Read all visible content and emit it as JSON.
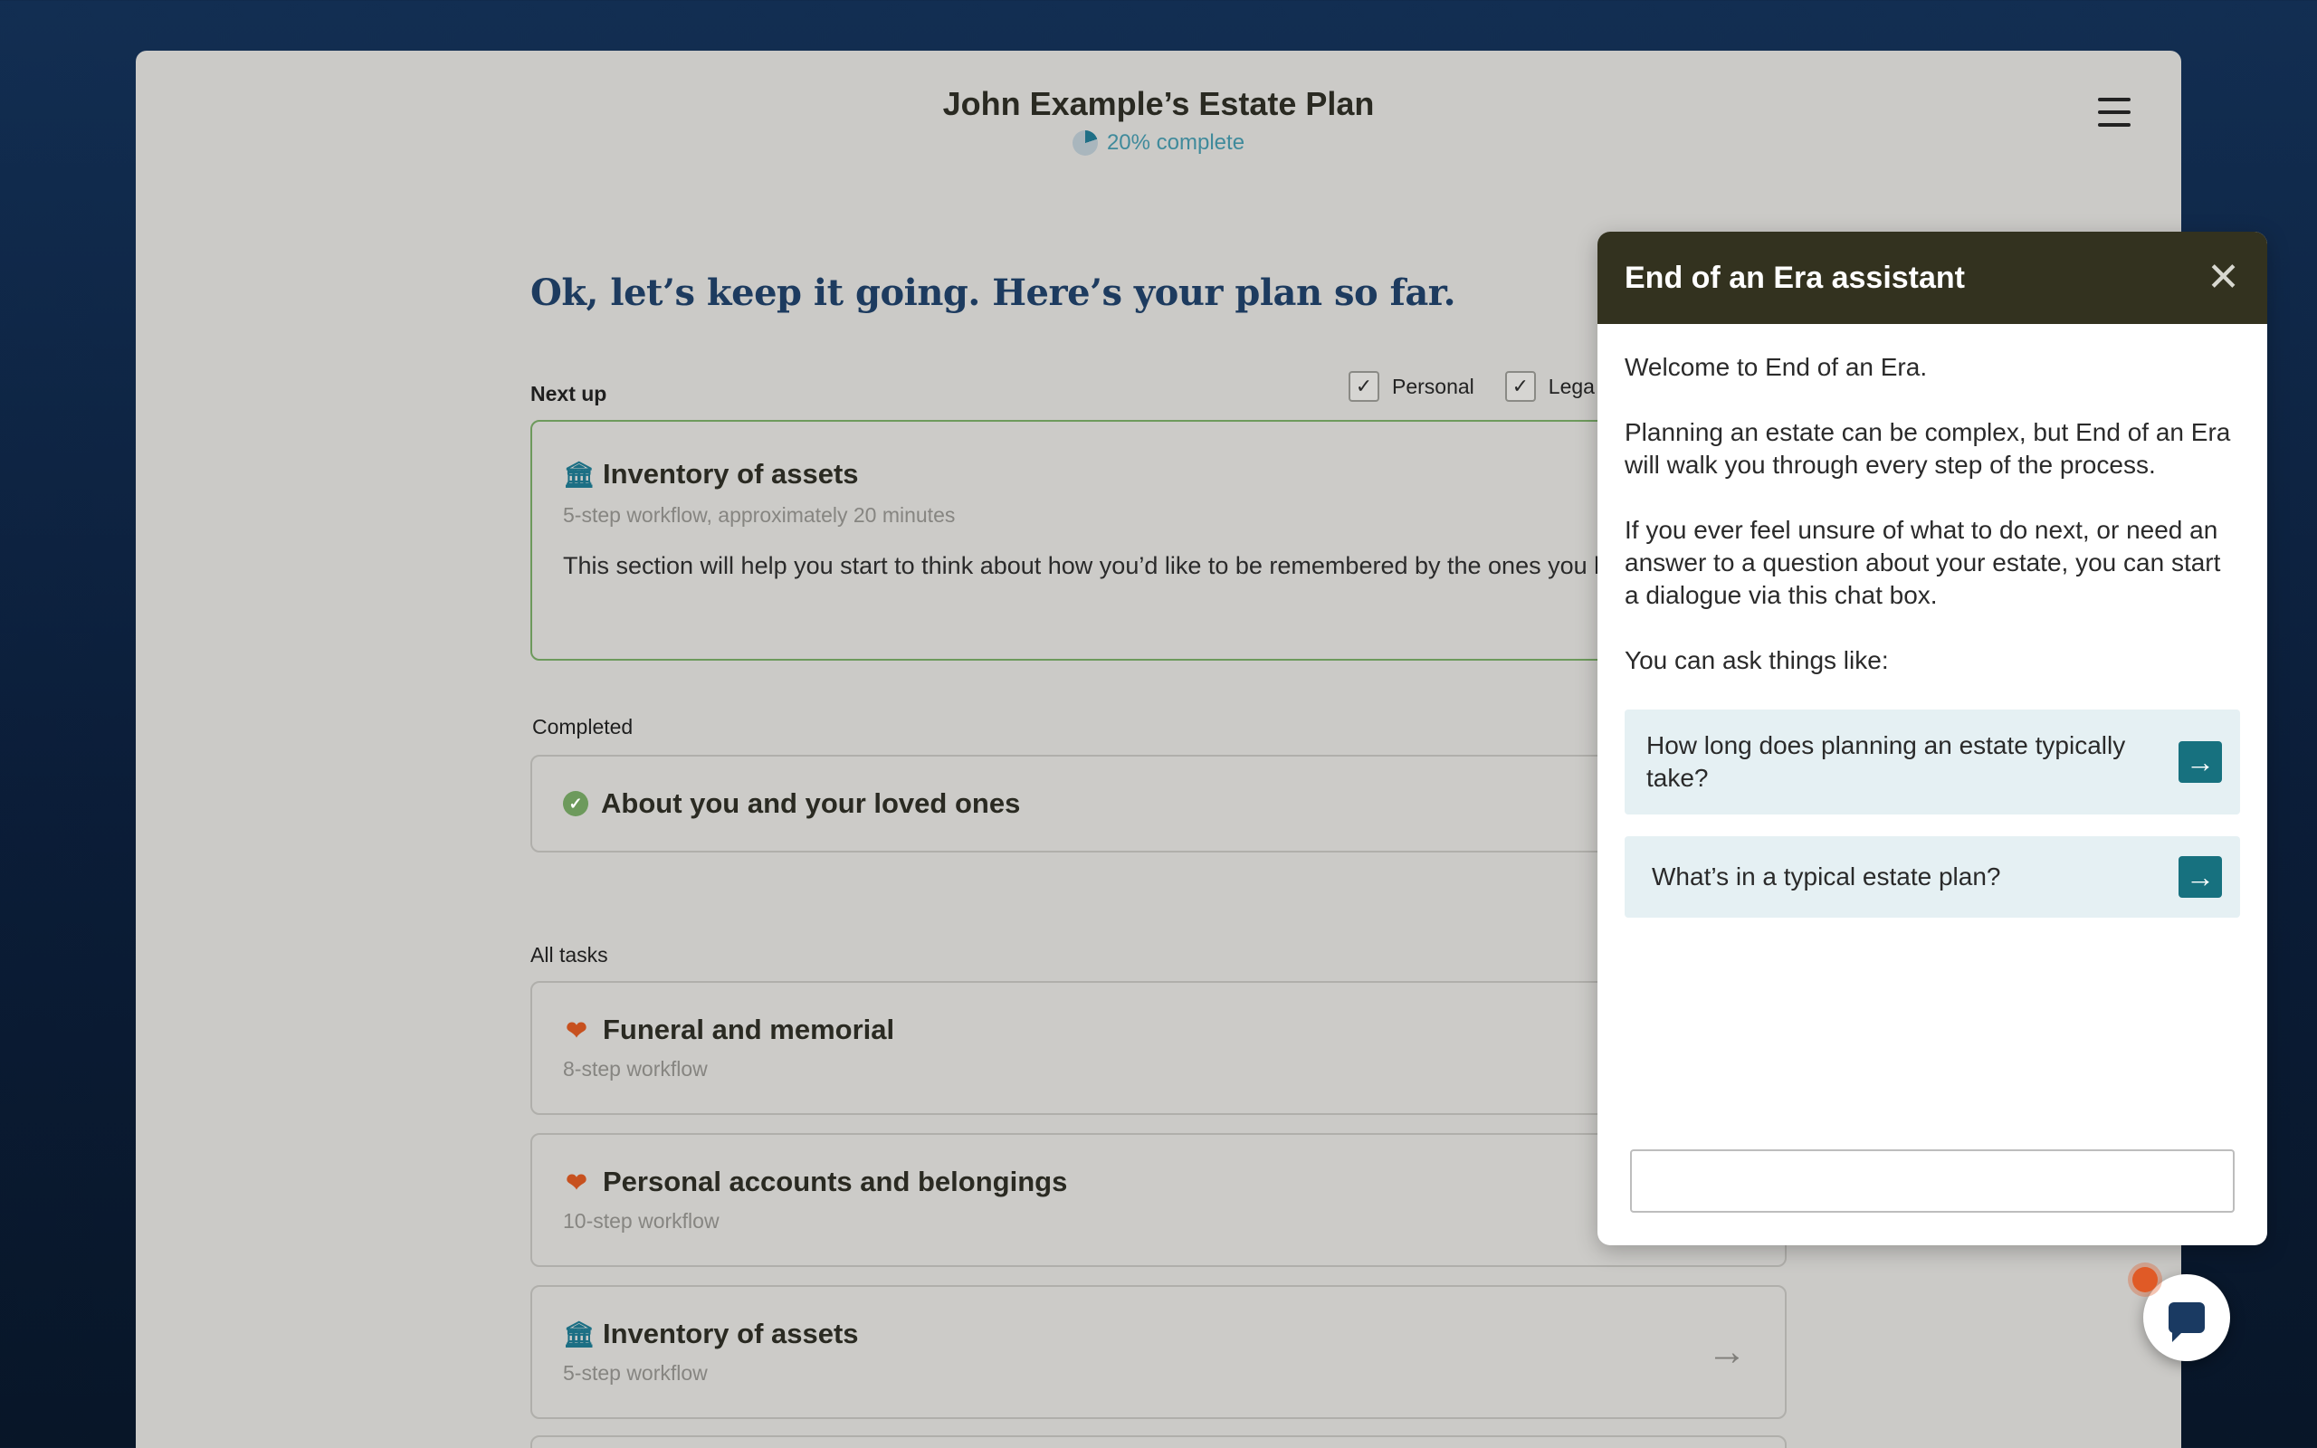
{
  "header": {
    "title": "John Example’s Estate Plan",
    "progress_text": "20% complete",
    "progress_value": 0.2
  },
  "main": {
    "heading": "Ok, let’s keep it going. Here’s your plan so far.",
    "next_up_label": "Next up",
    "completed_label": "Completed",
    "all_tasks_label": "All tasks",
    "filters": [
      {
        "label": "Personal",
        "checked": true
      },
      {
        "label": "Lega",
        "checked": true
      }
    ],
    "next_up": {
      "icon": "bank-icon",
      "title": "Inventory of assets",
      "subtitle": "5-step workflow, approximately 20 minutes",
      "description": "This section will help you start to think about how you’d like to be remembered by the ones you love the most."
    },
    "completed": {
      "icon": "check-circle-icon",
      "title": "About you and your loved ones"
    },
    "tasks": [
      {
        "icon": "heart-icon",
        "title": "Funeral and memorial",
        "subtitle": "8-step workflow"
      },
      {
        "icon": "heart-icon",
        "title": "Personal accounts and belongings",
        "subtitle": "10-step workflow"
      },
      {
        "icon": "bank-icon",
        "title": "Inventory of assets",
        "subtitle": "5-step workflow"
      }
    ]
  },
  "assistant": {
    "title": "End of an Era assistant",
    "messages": [
      "Welcome to End of an Era.",
      "Planning an estate can be complex, but End of an Era will walk you through every step of the process.",
      "If you ever feel unsure of what to do next, or need an answer to a question about your estate, you can start a dialogue via this chat box.",
      "You can ask things like:"
    ],
    "suggestions": [
      "How long does planning an estate typically take?",
      "What’s in a typical estate plan?"
    ],
    "input_value": ""
  },
  "colors": {
    "background": "#122e52",
    "card": "#cbcac7",
    "heading": "#1d3b5f",
    "accent_teal": "#17717f",
    "heart": "#c7511f",
    "success": "#6d9a5c",
    "assistant_header": "#33321f",
    "notification": "#e05a26"
  }
}
